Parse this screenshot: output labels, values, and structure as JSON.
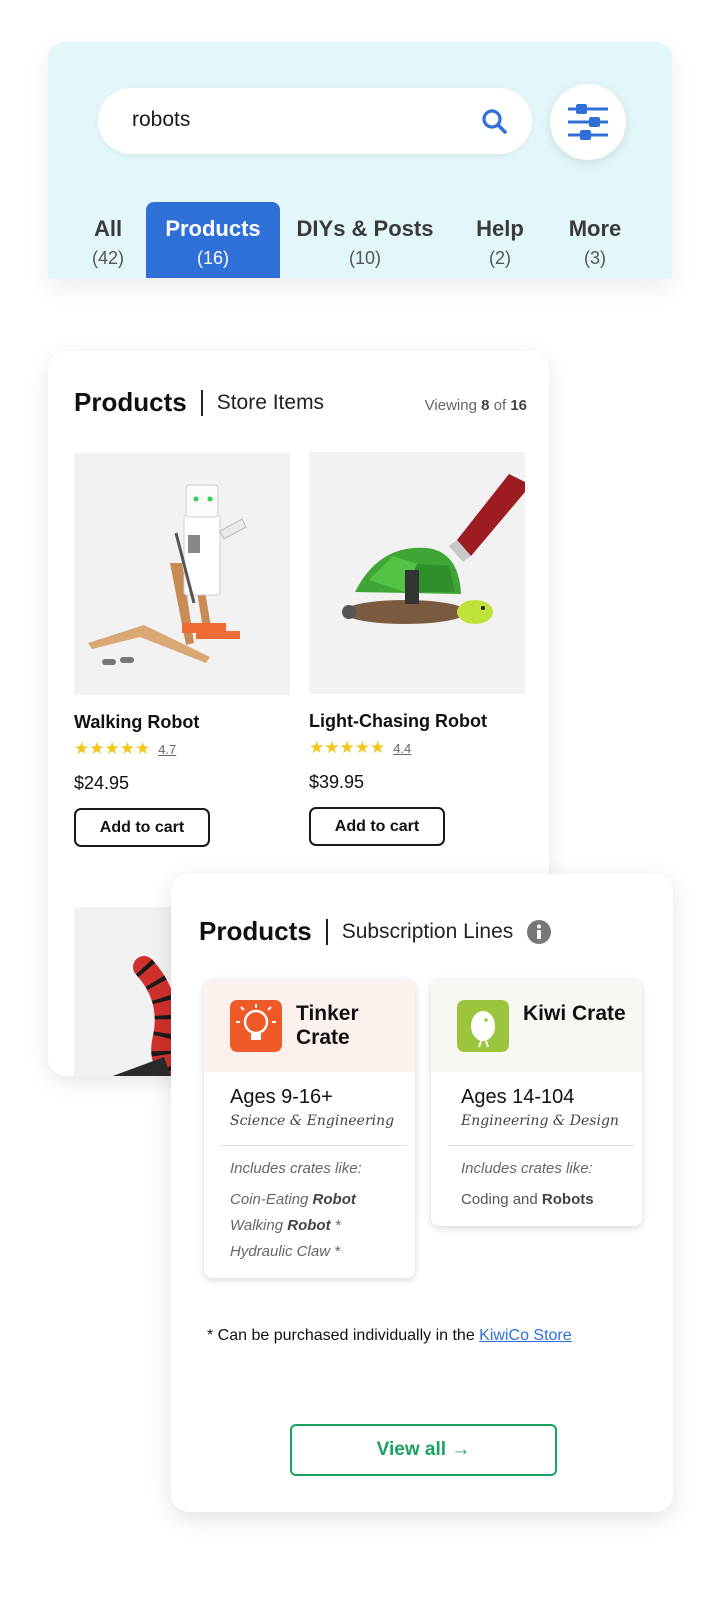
{
  "search": {
    "query": "robots"
  },
  "tabs": [
    {
      "label": "All",
      "count": "(42)"
    },
    {
      "label": "Products",
      "count": "(16)",
      "active": true
    },
    {
      "label": "DIYs & Posts",
      "count": "(10)"
    },
    {
      "label": "Help",
      "count": "(2)"
    },
    {
      "label": "More",
      "count": "(3)"
    }
  ],
  "store": {
    "title": "Products",
    "subtitle": "Store Items",
    "viewing_prefix": "Viewing",
    "viewing_count": "8",
    "viewing_of": "of",
    "viewing_total": "16",
    "products": [
      {
        "name": "Walking Robot",
        "stars": "★★★★★",
        "rating": "4.7",
        "price": "$24.95",
        "button": "Add to cart"
      },
      {
        "name": "Light-Chasing Robot",
        "stars": "★★★★★",
        "rating": "4.4",
        "price": "$39.95",
        "button": "Add to cart"
      }
    ]
  },
  "subscriptions": {
    "title": "Products",
    "subtitle": "Subscription Lines",
    "crates": [
      {
        "name": "Tinker Crate",
        "ages": "Ages 9-16+",
        "topic": "Science & Engineering",
        "includes_label": "Includes crates like:",
        "item1_pre": "Coin-Eating ",
        "item1_bold": "Robot",
        "item2_pre": "Walking ",
        "item2_bold": "Robot",
        "item2_post": " *",
        "item3": "Hydraulic Claw *",
        "header_color": "#fdf1ee",
        "logo_color": "#f05a28"
      },
      {
        "name": "Kiwi Crate",
        "ages": "Ages 14-104",
        "topic": "Engineering & Design",
        "includes_label": "Includes crates like:",
        "item1_pre": "Coding and ",
        "item1_bold": "Robots",
        "header_color": "#f8f8f2",
        "logo_color": "#9bc53d"
      }
    ],
    "footnote_text": "* Can be purchased individually in the ",
    "footnote_link": "KiwiCo Store",
    "view_all": "View all →"
  },
  "colors": {
    "accent_blue": "#2f6fd8",
    "panel_bg": "#e3f6f9",
    "star_yellow": "#f5c518",
    "green": "#1aa260"
  }
}
